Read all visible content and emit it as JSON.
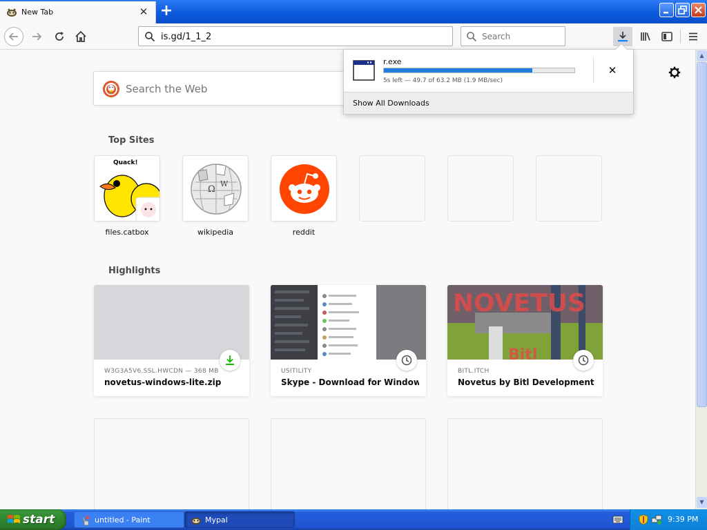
{
  "window": {
    "tab_title": "New Tab",
    "close_glyph": "✕",
    "new_tab_glyph": "+"
  },
  "navbar": {
    "url": "is.gd/1_1_2",
    "search_placeholder": "Search"
  },
  "content": {
    "web_search_placeholder": "Search the Web",
    "top_sites_title": "Top Sites",
    "highlights_title": "Highlights",
    "top_sites": [
      {
        "label": "files.catbox",
        "thumb_text": "Quack!"
      },
      {
        "label": "wikipedia"
      },
      {
        "label": "reddit"
      }
    ],
    "highlights": [
      {
        "source": "W3G3A5V6.SSL.HWCDN — 368 MB",
        "title": "novetus-windows-lite.zip",
        "badge_icon": "download-icon"
      },
      {
        "source": "USITILITY",
        "title": "Skype - Download for Windows ...",
        "badge_icon": "clock-icon"
      },
      {
        "source": "BITL.ITCH",
        "title": "Novetus by Bitl Development St...",
        "badge_icon": "clock-icon",
        "thumb_text": "NOVETUS",
        "thumb_subtext": "Bitl"
      }
    ]
  },
  "downloads_panel": {
    "filename": "r.exe",
    "progress_fraction": 0.78,
    "status": "5s left — 49.7 of 63.2 MB (1.9 MB/sec)",
    "cancel_glyph": "✕",
    "show_all": "Show All Downloads"
  },
  "taskbar": {
    "start_label": "start",
    "tasks": [
      {
        "label": "untitled - Paint"
      },
      {
        "label": "Mypal"
      }
    ],
    "clock": "9:39 PM"
  },
  "colors": {
    "accent": "#0a84ff",
    "progress": "#1e7fe0",
    "download_green": "#12bc00",
    "reddit": "#ff4500",
    "xp_blue": "#245edc"
  }
}
